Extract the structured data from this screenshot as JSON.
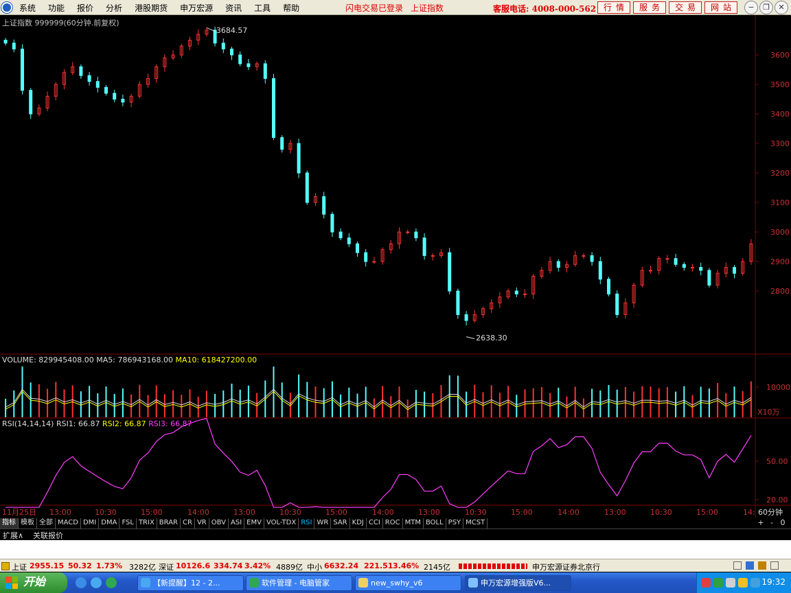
{
  "menu": {
    "items": [
      "系统",
      "功能",
      "报价",
      "分析",
      "港股期货",
      "申万宏源",
      "资讯",
      "工具",
      "帮助"
    ],
    "flash_login": "闪电交易已登录",
    "shindex_link": "上证指数",
    "hotline": "客服电话: 4008-000-562",
    "buttons": [
      "行情",
      "服务",
      "交易",
      "网站"
    ]
  },
  "main_chart": {
    "title": "上证指数 999999(60分钟.前复权)",
    "high_label": "3684.57",
    "low_label": "2638.30",
    "y_ticks": [
      "3600",
      "3500",
      "3400",
      "3300",
      "3200",
      "3100",
      "3000",
      "2900",
      "2800"
    ],
    "colors": {
      "up": "#ff3232",
      "down": "#54ffff",
      "grid": "#800000",
      "axis_text": "#c83232"
    }
  },
  "volume": {
    "title_prefix": "VOLUME: 829945408.00",
    "ma5_label": "MA5: 786943168.00",
    "ma10_label": "MA10: 618427200.00",
    "tick": "10000",
    "unit": "X10万"
  },
  "rsi": {
    "title_prefix": "RSI(14,14,14)",
    "rsi1_label": "RSI1: 66.87",
    "rsi2_label": "RSI2: 66.87",
    "rsi3_label": "RSI3: 66.87",
    "ticks": [
      "50.00",
      "20.00"
    ]
  },
  "time_axis": [
    "11月25日",
    "13:00",
    "10:30",
    "15:00",
    "14:00",
    "13:00",
    "10:30",
    "15:00",
    "14:00",
    "13:00",
    "10:30",
    "15:00",
    "14:00",
    "13:00",
    "10:30",
    "15:00",
    "14:"
  ],
  "period": "60分钟",
  "tabs": [
    "指标",
    "模板",
    "全部",
    "MACD",
    "DMI",
    "DMA",
    "FSL",
    "TRIX",
    "BRAR",
    "CR",
    "VR",
    "OBV",
    "ASI",
    "EMV",
    "VOL-TDX",
    "RSI",
    "WR",
    "SAR",
    "KDJ",
    "CCI",
    "ROC",
    "MTM",
    "BOLL",
    "PSY",
    "MCST"
  ],
  "tab_controls": [
    "+",
    "-",
    "0"
  ],
  "ext_row": [
    "扩展∧",
    "关联报价"
  ],
  "status": {
    "sh_label": "上证",
    "sh_value": "2955.15",
    "sh_change": "50.32",
    "sh_pct": "1.73%",
    "sh_amount": "3282亿",
    "sz_label": "深证",
    "sz_value": "10126.6",
    "sz_change": "334.74",
    "sz_pct": "3.42%",
    "sz_amount": "4889亿",
    "zx_label": "中小",
    "zx_value": "6632.24",
    "zx_change": "221.51",
    "zx_pct": "3.46%",
    "zx_amount": "2145亿",
    "broker": "申万宏源证券北京行"
  },
  "taskbar": {
    "start": "开始",
    "tasks": [
      "【新提醒】12 - 2...",
      "软件管理 - 电脑管家",
      "new_swhy_v6",
      "申万宏源增强版V6..."
    ],
    "clock": "19:32"
  },
  "chart_data": {
    "type": "candlestick",
    "series_close": [
      3640,
      3620,
      3480,
      3400,
      3420,
      3460,
      3500,
      3540,
      3560,
      3530,
      3510,
      3490,
      3470,
      3450,
      3440,
      3460,
      3500,
      3520,
      3560,
      3590,
      3600,
      3630,
      3650,
      3670,
      3684,
      3640,
      3620,
      3600,
      3570,
      3560,
      3570,
      3520,
      3320,
      3280,
      3300,
      3200,
      3100,
      3120,
      3060,
      3000,
      2980,
      2960,
      2930,
      2900,
      2900,
      2940,
      2960,
      3000,
      3000,
      2980,
      2920,
      2920,
      2930,
      2800,
      2720,
      2700,
      2720,
      2740,
      2760,
      2780,
      2800,
      2790,
      2790,
      2850,
      2870,
      2900,
      2880,
      2890,
      2920,
      2920,
      2900,
      2840,
      2790,
      2720,
      2760,
      2820,
      2870,
      2870,
      2910,
      2910,
      2890,
      2880,
      2880,
      2870,
      2820,
      2860,
      2880,
      2860,
      2900,
      2960
    ]
  }
}
